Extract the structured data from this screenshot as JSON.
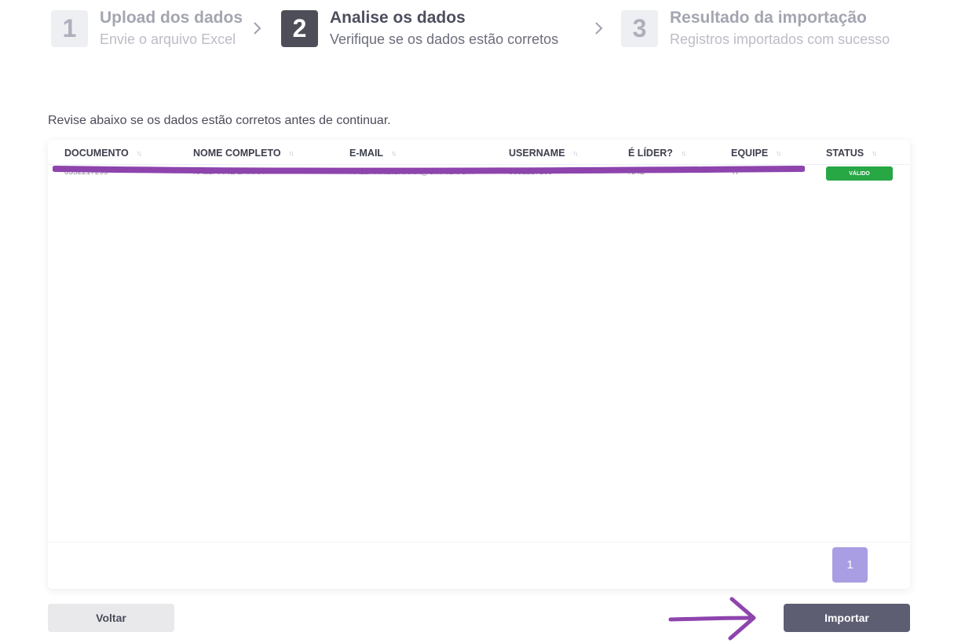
{
  "stepper": {
    "steps": [
      {
        "number": "1",
        "title": "Upload dos dados",
        "subtitle": "Envie o arquivo Excel",
        "state": "inactive"
      },
      {
        "number": "2",
        "title": "Analise os dados",
        "subtitle": "Verifique se os dados estão corretos",
        "state": "active"
      },
      {
        "number": "3",
        "title": "Resultado da importação",
        "subtitle": "Registros importados com sucesso",
        "state": "inactive"
      }
    ]
  },
  "intro_text": "Revise abaixo se os dados estão corretos antes de continuar.",
  "table": {
    "columns": [
      "DOCUMENTO",
      "NOME COMPLETO",
      "E-MAIL",
      "USERNAME",
      "É LÍDER?",
      "EQUIPE",
      "STATUS"
    ],
    "sort_icon": "sort-arrows-icon",
    "rows": [
      {
        "documento": "0352217299",
        "nome": "KALBANNE BARRA",
        "email": "KALBANNE.BARRA@GMAIL.COM",
        "username": "0352217299",
        "lider": "NÃO",
        "equipe": "TI",
        "status": "VÁLIDO"
      }
    ]
  },
  "pagination": {
    "current_page": "1"
  },
  "buttons": {
    "back": "Voltar",
    "import": "Importar"
  },
  "colors": {
    "active_step": "#4d4e57",
    "status_valid": "#28a745",
    "pagination_active": "#a99ee3",
    "import_button": "#5d5e72",
    "annotation_purple": "#8e44ad"
  }
}
